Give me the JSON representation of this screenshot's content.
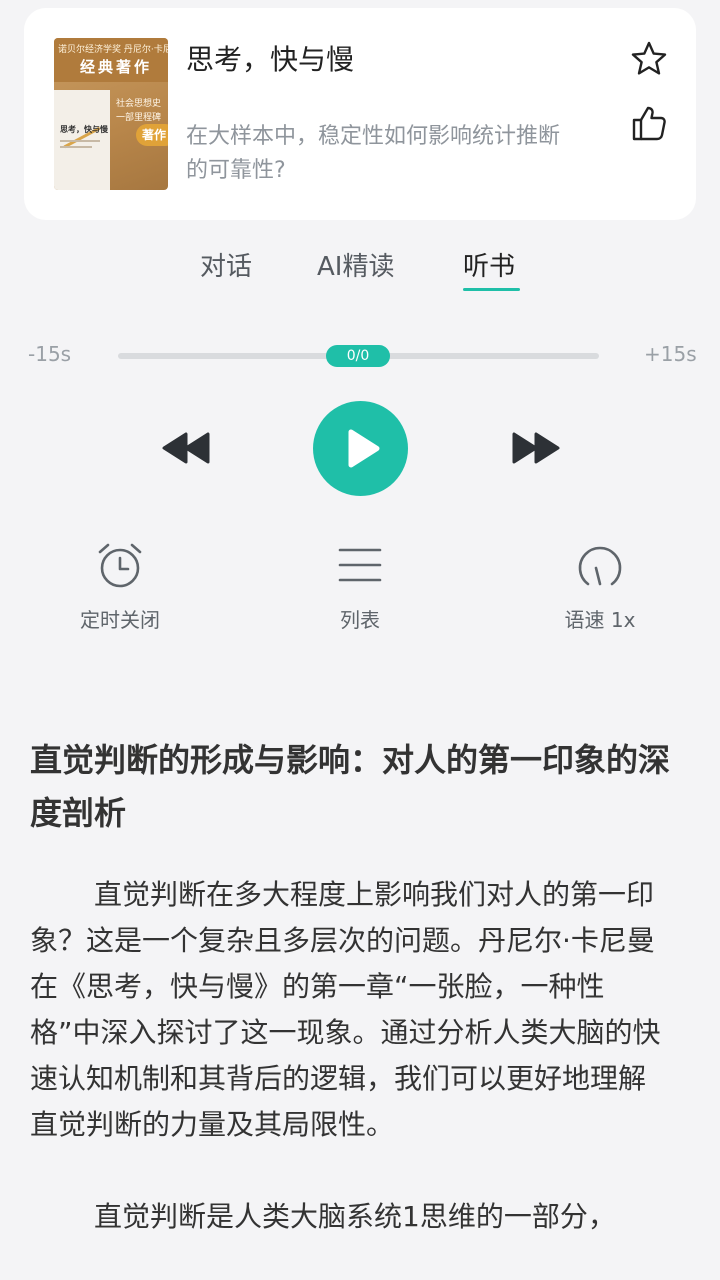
{
  "book": {
    "cover": {
      "series": "诺贝尔经济学奖 丹尼尔·卡尼曼",
      "classic": "经典著作",
      "mini_title": "思考，快与慢",
      "side_line_1": "社会思想史",
      "side_line_2": "一部里程碑",
      "badge": "著作"
    },
    "title": "思考，快与慢",
    "question": "在大样本中，稳定性如何影响统计推断的可靠性?"
  },
  "tabs": [
    {
      "label": "对话",
      "active": false
    },
    {
      "label": "AI精读",
      "active": false
    },
    {
      "label": "听书",
      "active": true
    }
  ],
  "player": {
    "back_label": "-15s",
    "forward_label": "+15s",
    "progress_text": "0/0",
    "progress": 0.0,
    "accent_color": "#1fbfa8"
  },
  "controls": {
    "timer": {
      "label": "定时关闭",
      "icon": "alarm-clock-icon"
    },
    "list": {
      "label": "列表",
      "icon": "list-icon"
    },
    "speed": {
      "label": "语速 1x",
      "icon": "speedometer-icon"
    }
  },
  "article": {
    "title": "直觉判断的形成与影响：对人的第一印象的深度剖析",
    "paragraphs": [
      "直觉判断在多大程度上影响我们对人的第一印象？这是一个复杂且多层次的问题。丹尼尔·卡尼曼在《思考，快与慢》的第一章“一张脸，一种性格”中深入探讨了这一现象。通过分析人类大脑的快速认知机制和其背后的逻辑，我们可以更好地理解直觉判断的力量及其局限性。",
      "直觉判断是人类大脑系统1思维的一部分，"
    ]
  }
}
